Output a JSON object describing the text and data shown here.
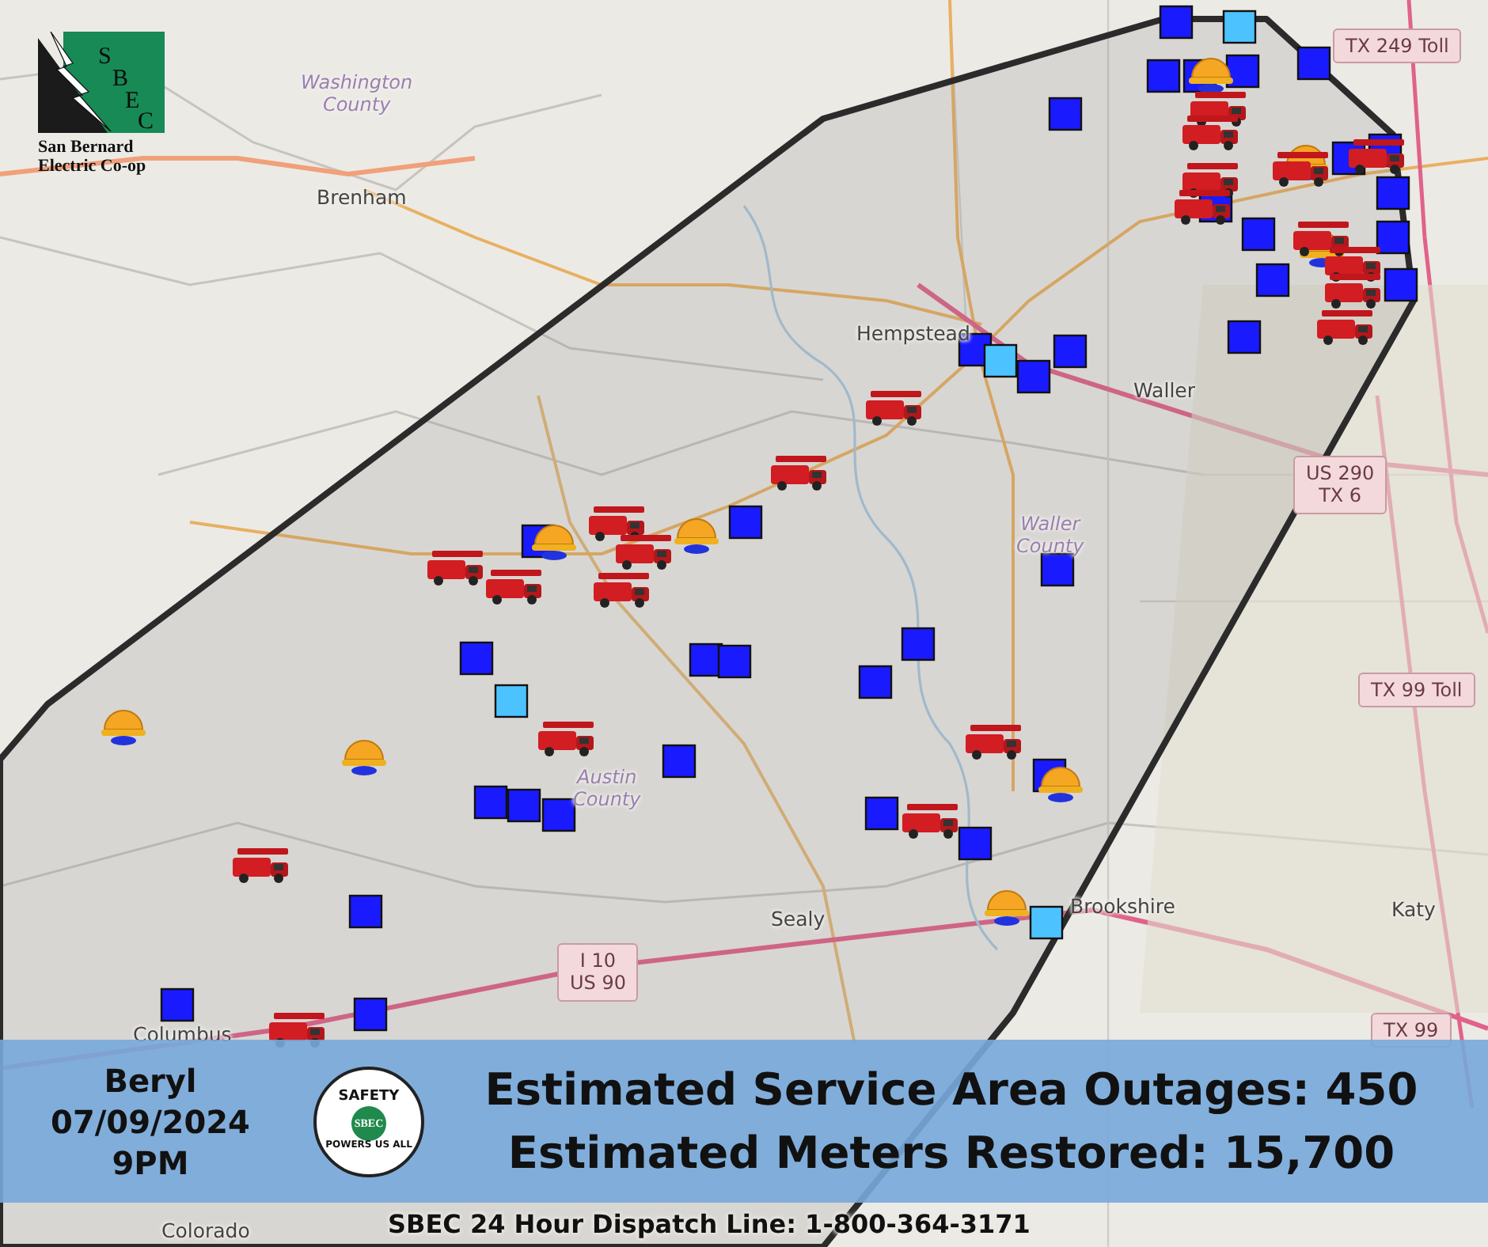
{
  "logo": {
    "letters": [
      "S",
      "B",
      "E",
      "C"
    ],
    "name_lines": [
      "San Bernard",
      "Electric Co-op"
    ]
  },
  "map": {
    "county_labels": [
      {
        "text": "Washington\nCounty",
        "kind": "county"
      },
      {
        "text": "Waller\nCounty",
        "kind": "county"
      },
      {
        "text": "Austin\nCounty",
        "kind": "county"
      }
    ],
    "town_labels": [
      "Brenham",
      "Hempstead",
      "Waller",
      "Sealy",
      "Brookshire",
      "Katy",
      "Columbus",
      "Colorado"
    ],
    "shields": [
      "TX 249 Toll",
      "US 290\nTX 6",
      "TX 99 Toll",
      "I 10\nUS 90",
      "TX 99"
    ]
  },
  "banner": {
    "event": "Beryl",
    "date": "07/09/2024",
    "time": "9PM",
    "badge": {
      "top": "SAFETY",
      "center": "SBEC",
      "bottom": "POWERS US ALL"
    },
    "headlines": [
      "Estimated Service Area Outages: 450",
      "Estimated Meters Restored: 15,700"
    ]
  },
  "footer": {
    "dispatch_line": "SBEC 24 Hour Dispatch Line: 1-800-364-3171"
  }
}
